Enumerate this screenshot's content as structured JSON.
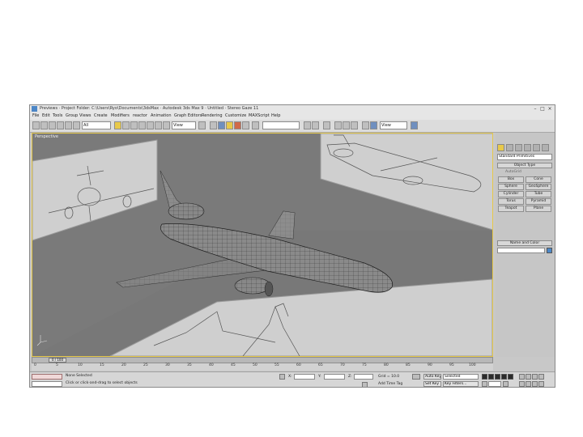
{
  "window": {
    "title": "Previews · Project Folder: C:\\Users\\Ryo\\Documents\\3dsMax · Autodesk 3ds Max 9 · Untitled · Stereo Gaze 11"
  },
  "menu": [
    "File",
    "Edit",
    "Tools",
    "Group",
    "Views",
    "Create",
    "Modifiers",
    "reactor",
    "Animation",
    "Graph Editors",
    "Rendering",
    "Customize",
    "MAXScript",
    "Help"
  ],
  "toolbar": {
    "selection_filter": "All",
    "coord_system": "View",
    "named_selection": "",
    "render_type": "View"
  },
  "viewport": {
    "label": "Perspective",
    "frame_counter": "0 / 100"
  },
  "command_panel": {
    "category_dropdown": "Standard Primitives",
    "object_type_header": "Object Type",
    "autogrid_label": "AutoGrid",
    "buttons": [
      "Box",
      "Cone",
      "Sphere",
      "GeoSphere",
      "Cylinder",
      "Tube",
      "Torus",
      "Pyramid",
      "Teapot",
      "Plane"
    ],
    "name_color_header": "Name and Color",
    "accent_color": "#4c88c8"
  },
  "timeline": {
    "ticks": [
      "0",
      "5",
      "10",
      "15",
      "20",
      "25",
      "30",
      "35",
      "40",
      "45",
      "50",
      "55",
      "60",
      "65",
      "70",
      "75",
      "80",
      "85",
      "90",
      "95",
      "100"
    ]
  },
  "status": {
    "selection": "None Selected",
    "prompt": "Click or click-and-drag to select objects",
    "x_label": "X:",
    "y_label": "Y:",
    "z_label": "Z:",
    "grid": "Grid = 10.0",
    "add_time_tag": "Add Time Tag",
    "auto_key": "Auto Key",
    "selected_dropdown": "Selected",
    "set_key": "Set Key",
    "key_filters": "Key Filters..."
  }
}
